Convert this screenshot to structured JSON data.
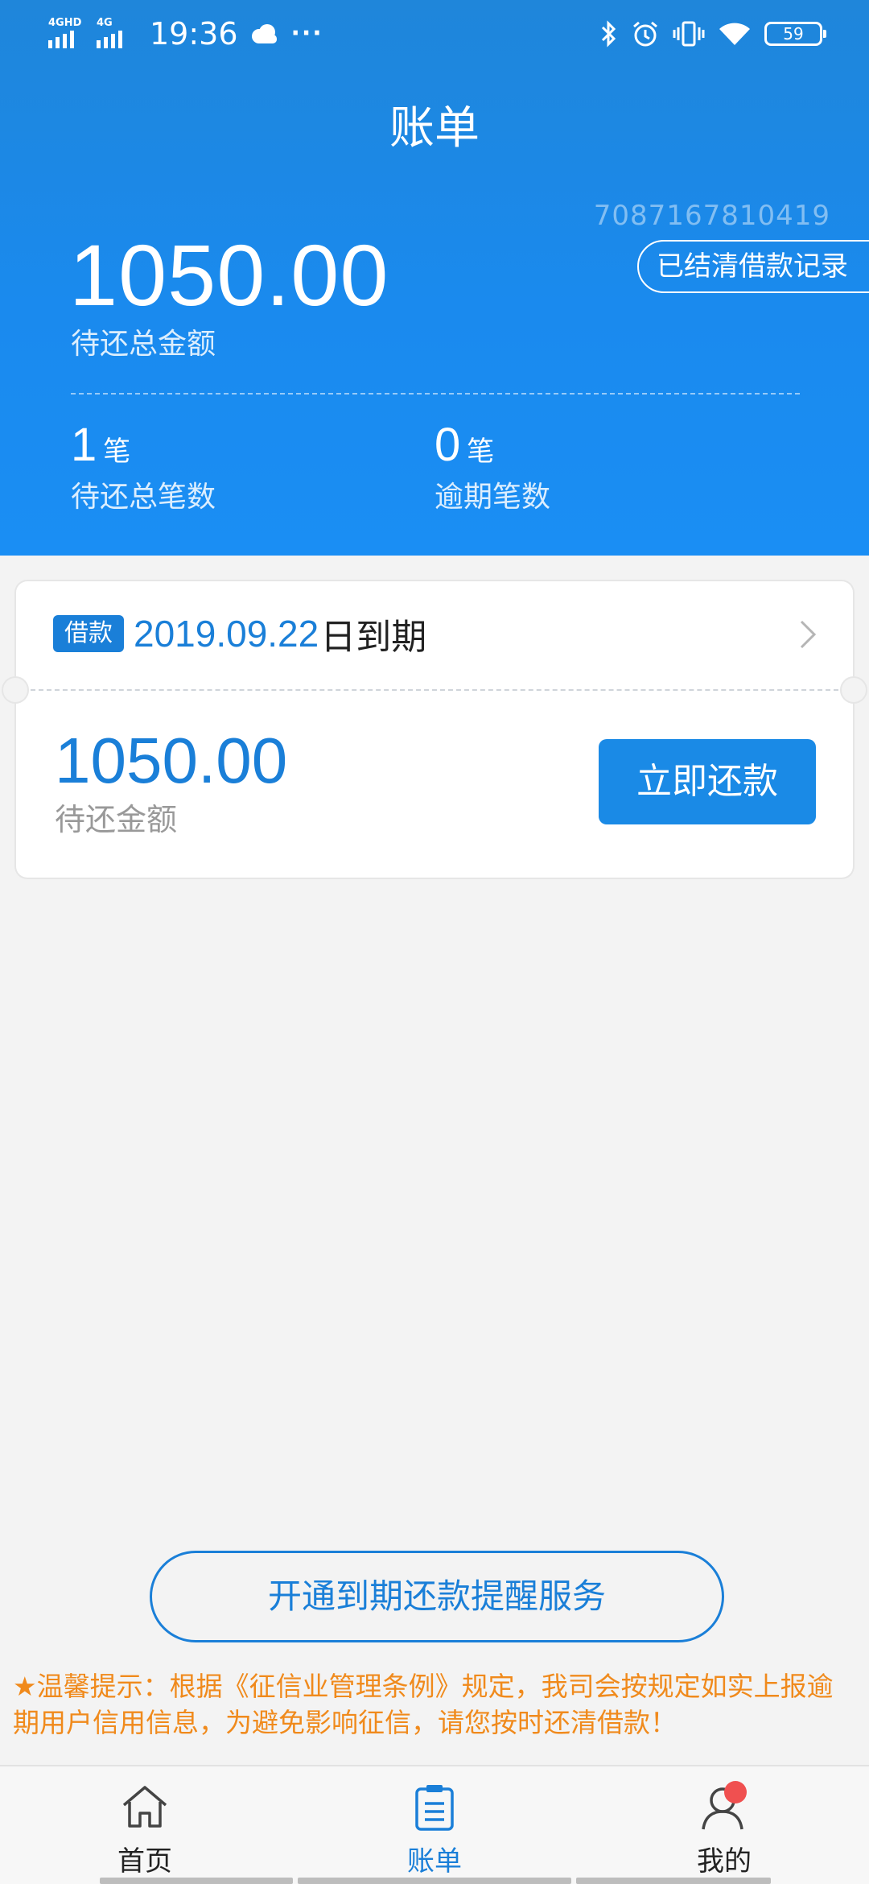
{
  "status_bar": {
    "network_1": "4GHD",
    "network_2": "4G",
    "time": "19:36",
    "more": "···",
    "battery": "59"
  },
  "header": {
    "title": "账单",
    "account_id": "7087167810419",
    "settled_button": "已结清借款记录",
    "total_amount": "1050.00",
    "total_label": "待还总金额",
    "count_value": "1",
    "count_unit": "笔",
    "count_label": "待还总笔数",
    "overdue_value": "0",
    "overdue_unit": "笔",
    "overdue_label": "逾期笔数"
  },
  "bill": {
    "badge": "借款",
    "due_date": "2019.09.22",
    "due_suffix": "日到期",
    "amount": "1050.00",
    "amount_label": "待还金额",
    "pay_button": "立即还款"
  },
  "reminder": {
    "button": "开通到期还款提醒服务",
    "tips": "★温馨提示：根据《征信业管理条例》规定，我司会按规定如实上报逾期用户信用信息，为避免影响征信，请您按时还清借款！"
  },
  "nav": {
    "home": "首页",
    "bill": "账单",
    "mine": "我的",
    "active": "bill"
  },
  "colors": {
    "primary": "#1a8ae6",
    "accent_text": "#1a7fd8",
    "warning": "#f08a1c",
    "badge_dot": "#f05050"
  }
}
